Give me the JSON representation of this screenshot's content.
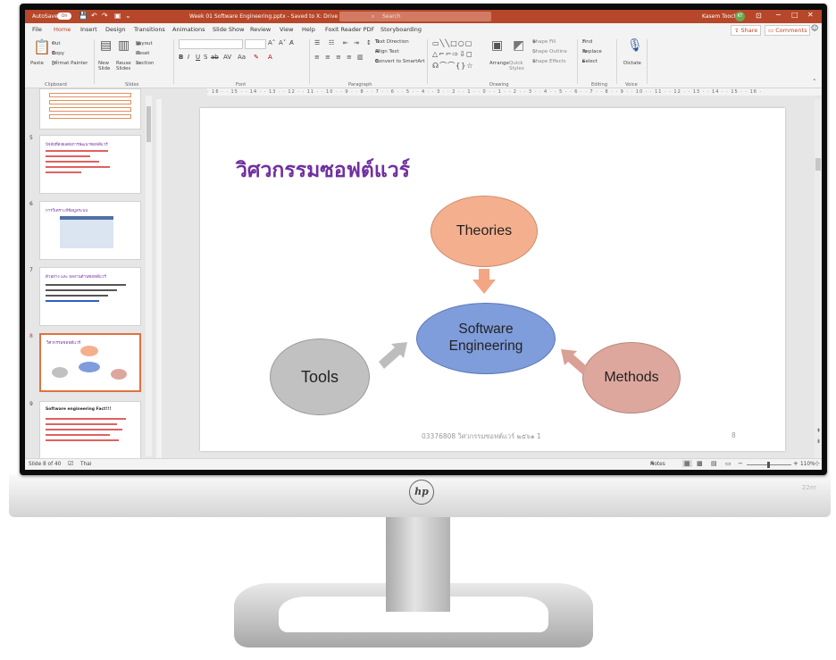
{
  "window": {
    "autosave_label": "AutoSave",
    "autosave_toggle": "On",
    "title": "Week 01 Software Engineering.pptx - Saved to X: Drive",
    "search_placeholder": "Search",
    "user_name": "Kasem Toochu",
    "user_initials": "KT"
  },
  "tabs": [
    "File",
    "Home",
    "Insert",
    "Design",
    "Transitions",
    "Animations",
    "Slide Show",
    "Review",
    "View",
    "Help",
    "Foxit Reader PDF",
    "Storyboarding"
  ],
  "share_label": "Share",
  "comments_label": "Comments",
  "ribbon": {
    "clipboard": {
      "paste": "Paste",
      "cut": "Cut",
      "copy": "Copy",
      "format_painter": "Format Painter",
      "group": "Clipboard"
    },
    "slides": {
      "new_slide": "New Slide",
      "reuse_slides": "Reuse Slides",
      "layout": "Layout",
      "reset": "Reset",
      "section": "Section",
      "group": "Slides"
    },
    "font": {
      "group": "Font"
    },
    "paragraph": {
      "text_direction": "Text Direction",
      "align_text": "Align Text",
      "convert_smartart": "Convert to SmartArt",
      "group": "Paragraph"
    },
    "drawing": {
      "arrange": "Arrange",
      "quick_styles": "Quick Styles",
      "shape_fill": "Shape Fill",
      "shape_outline": "Shape Outline",
      "shape_effects": "Shape Effects",
      "group": "Drawing"
    },
    "editing": {
      "find": "Find",
      "replace": "Replace",
      "select": "Select",
      "group": "Editing"
    },
    "voice": {
      "dictate": "Dictate",
      "group": "Voice"
    }
  },
  "ruler_text": "· 16 · · 15 · · 14 · · 13 · · 12 · · 11 · · 10 · · 9 · · 8 · · 7 · · 6 · · 5 · · 4 · · 3 · · 2 · · 1 · · 0 · · 1 · · 2 · · 3 · · 4 · · 5 · · 6 · · 7 · · 8 · · 9 · · 10 · · 11 · · 12 · · 13 · · 14 · · 15 · · 16 ·",
  "thumbnails": [
    {
      "num": "5",
      "title": "ปัจจัยที่ส่งผลต่อการพัฒนาซอฟต์แวร์"
    },
    {
      "num": "6",
      "title": "การวิเคราะห์ข้อมูลระบบ"
    },
    {
      "num": "7",
      "title": "ตัวอย่าง และ ผลงานด้านซอฟต์แวร์"
    },
    {
      "num": "8",
      "title": "วิศวกรรมซอฟต์แวร์"
    },
    {
      "num": "9",
      "title": "Software engineering Fact!!!"
    }
  ],
  "slide": {
    "title": "วิศวกรรมซอฟต์แวร์",
    "theories": "Theories",
    "software_engineering_line1": "Software",
    "software_engineering_line2": "Engineering",
    "tools": "Tools",
    "methods": "Methods",
    "footer": "03376808 วิศวกรรมซอฟต์แวร์ ๒๕๖๑ 1",
    "page_number": "8"
  },
  "status": {
    "slide_of": "Slide 8 of 40",
    "language": "Thai",
    "notes": "Notes",
    "zoom": "110%"
  },
  "monitor": {
    "brand": "hp",
    "model": "22er"
  },
  "colors": {
    "title_bar": "#b7472a",
    "theories": "#f4b08e",
    "software_engineering": "#7f9cdb",
    "tools": "#c1c1c1",
    "methods": "#dea79d",
    "slide_title": "#7030a0"
  }
}
